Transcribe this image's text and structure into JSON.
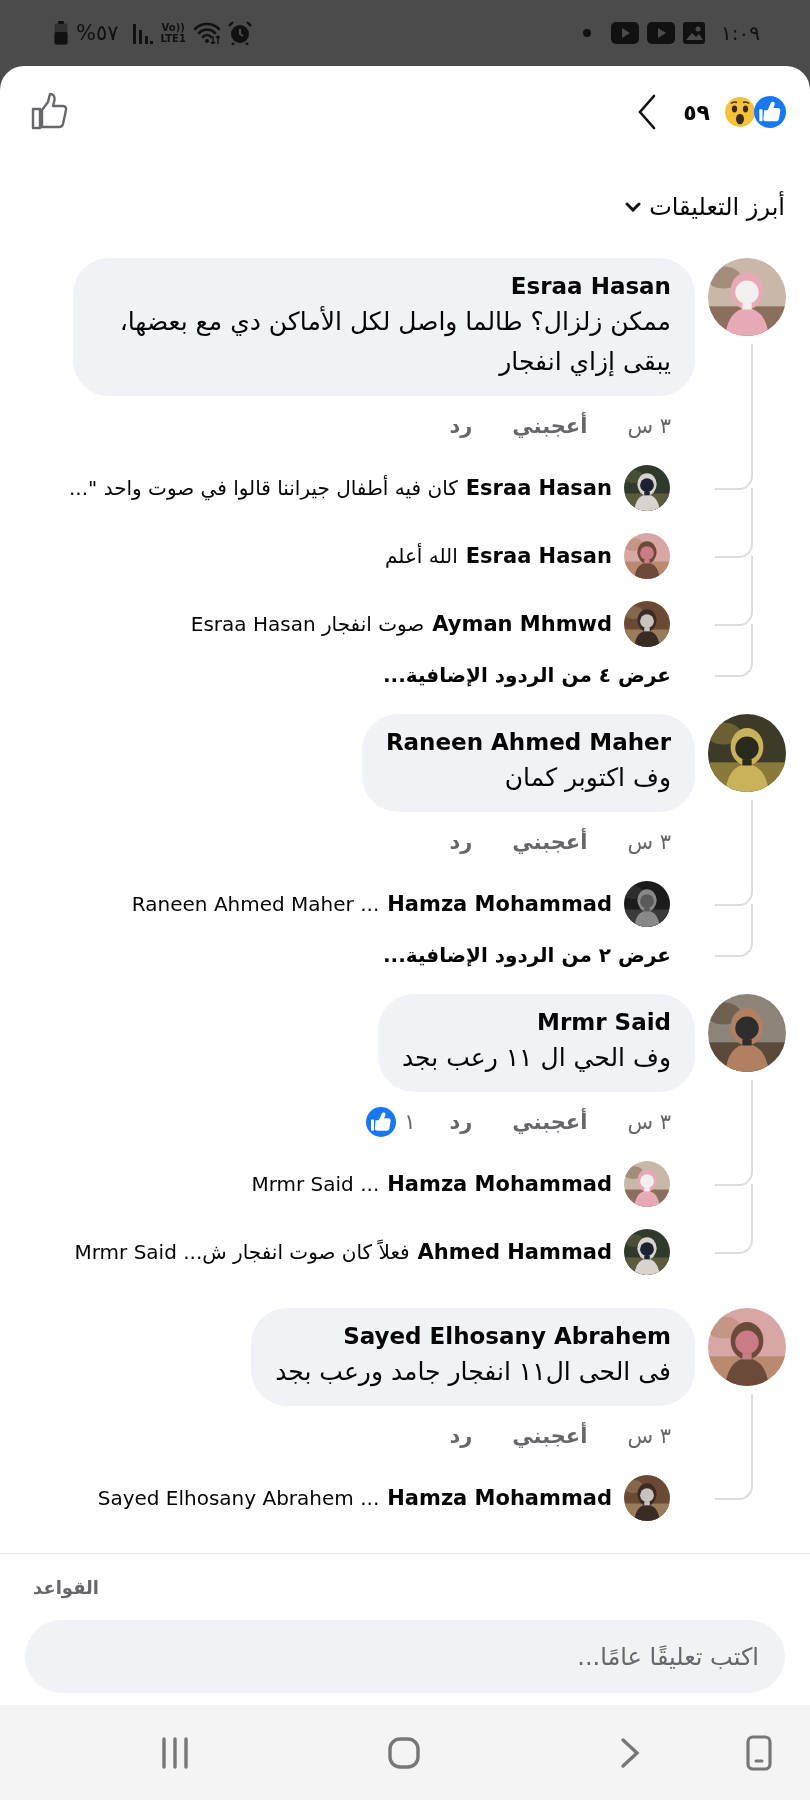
{
  "status_bar": {
    "battery": "%٥٧",
    "network": "Vo))\nLTE1",
    "time": "١:٠٩"
  },
  "header": {
    "reaction_count": "٥٩"
  },
  "sort": {
    "label": "أبرز التعليقات"
  },
  "comments": [
    {
      "author": "Esraa Hasan",
      "text": "ممكن زلزال؟ طالما واصل لكل الأماكن دي مع بعضها، يبقى إزاي انفجار",
      "time": "٣ س",
      "like_label": "أعجبني",
      "reply_label": "رد",
      "replies": [
        {
          "author": "Esraa Hasan",
          "text": "كان فيه أطفال جيراننا قالوا في صوت واحد \"..."
        },
        {
          "author": "Esraa Hasan",
          "text": "الله أعلم"
        },
        {
          "author": "Ayman Mhmwd",
          "text": "صوت انفجار Esraa Hasan"
        }
      ],
      "more_replies": "عرض ٤ من الردود الإضافية..."
    },
    {
      "author": "Raneen Ahmed Maher",
      "text": "وف اكتوبر كمان",
      "time": "٣ س",
      "like_label": "أعجبني",
      "reply_label": "رد",
      "replies": [
        {
          "author": "Hamza Mohammad",
          "text": "... Raneen Ahmed Maher"
        }
      ],
      "more_replies": "عرض ٢ من الردود الإضافية..."
    },
    {
      "author": "Mrmr Said",
      "text": "وف الحي ال ١١ رعب بجد",
      "time": "٣ س",
      "like_label": "أعجبني",
      "reply_label": "رد",
      "like_count": "١",
      "replies": [
        {
          "author": "Hamza Mohammad",
          "text": "... Mrmr Said"
        },
        {
          "author": "Ahmed Hammad",
          "text": "فعلاً كان صوت انفجار ش... Mrmr Said"
        }
      ]
    },
    {
      "author": "Sayed Elhosany Abrahem",
      "text": "فى الحى ال١١ انفجار جامد ورعب بجد",
      "time": "٣ س",
      "like_label": "أعجبني",
      "reply_label": "رد",
      "replies": [
        {
          "author": "Hamza Mohammad",
          "text": "... Sayed Elhosany Abrahem"
        }
      ]
    }
  ],
  "composer": {
    "rules": "القواعد",
    "placeholder": "اكتب تعليقًا عامًا..."
  }
}
